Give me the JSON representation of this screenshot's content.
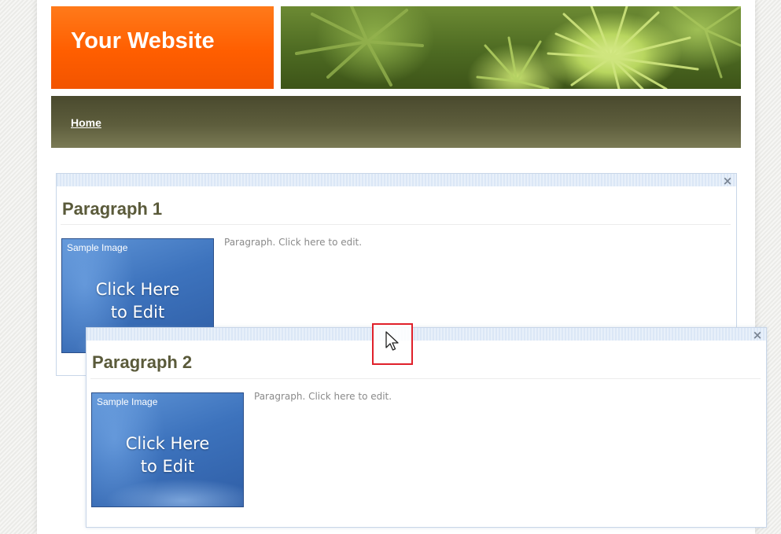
{
  "site": {
    "title": "Your Website"
  },
  "nav": {
    "items": [
      {
        "label": "Home"
      }
    ]
  },
  "blocks": [
    {
      "heading": "Paragraph 1",
      "text": "Paragraph. Click here to edit.",
      "image": {
        "label": "Sample Image",
        "cta_line1": "Click Here",
        "cta_line2": "to Edit"
      },
      "close_icon": "close-icon"
    },
    {
      "heading": "Paragraph 2",
      "text": "Paragraph. Click here to edit.",
      "image": {
        "label": "Sample Image",
        "cta_line1": "Click Here",
        "cta_line2": "to Edit"
      },
      "close_icon": "close-icon"
    }
  ],
  "colors": {
    "logo_orange": "#ff5e00",
    "nav_olive": "#5d5d3c",
    "heading_olive": "#5a5a3a",
    "highlight_red": "#e0202a"
  },
  "cursor": {
    "icon": "mouse-pointer-icon"
  }
}
